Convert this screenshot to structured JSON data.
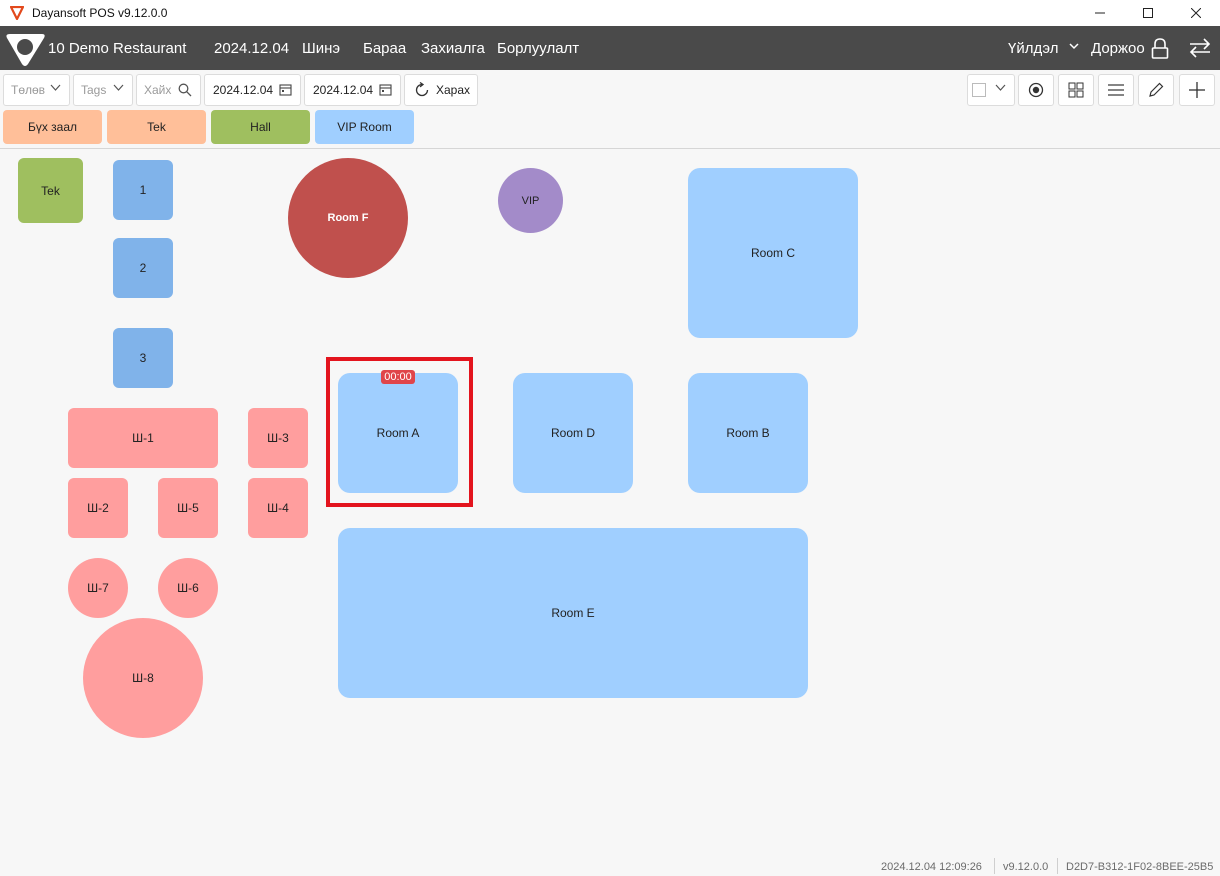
{
  "window": {
    "title": "Dayansoft POS v9.12.0.0"
  },
  "header": {
    "brand": "10 Demo Restaurant",
    "nav": [
      "2024.12.04",
      "Шинэ",
      "Бараа",
      "Захиалга",
      "Борлуулалт"
    ],
    "menu_label": "Үйлдэл",
    "user_label": "Доржоо"
  },
  "toolbar": {
    "status_placeholder": "Төлөв",
    "tags_placeholder": "Tags",
    "search_placeholder": "Хайх",
    "date_from": "2024.12.04",
    "date_to": "2024.12.04",
    "refresh_label": "Харах"
  },
  "areas": [
    {
      "label": "Бүх заал",
      "color": "#ffbf99"
    },
    {
      "label": "Tek",
      "color": "#ffbf99"
    },
    {
      "label": "Hall",
      "color": "#9fbf5f"
    },
    {
      "label": "VIP Room",
      "color": "#a0cfff"
    }
  ],
  "tables": {
    "tek": "Tek",
    "t1": "1",
    "t2": "2",
    "t3": "3",
    "sh1": "Ш-1",
    "sh2": "Ш-2",
    "sh3": "Ш-3",
    "sh4": "Ш-4",
    "sh5": "Ш-5",
    "sh6": "Ш-6",
    "sh7": "Ш-7",
    "sh8": "Ш-8",
    "room_f": "Room F",
    "vip": "VIP",
    "room_c": "Room C",
    "room_a": "Room A",
    "room_d": "Room D",
    "room_b": "Room B",
    "room_e": "Room E"
  },
  "selected_timer": "00:00",
  "statusbar": {
    "datetime": "2024.12.04 12:09:26",
    "version": "v9.12.0.0",
    "device_id": "D2D7-B312-1F02-8BEE-25B5"
  },
  "colors": {
    "header_bg": "#4a4a4a",
    "tek_green": "#9fbf5f",
    "blue_small": "#80b3ea",
    "blue_room": "#a0cfff",
    "pink": "#ff9e9e",
    "room_f_red": "#c0504d",
    "vip_purple": "#a38bc9",
    "highlight_red": "#e3141e"
  }
}
